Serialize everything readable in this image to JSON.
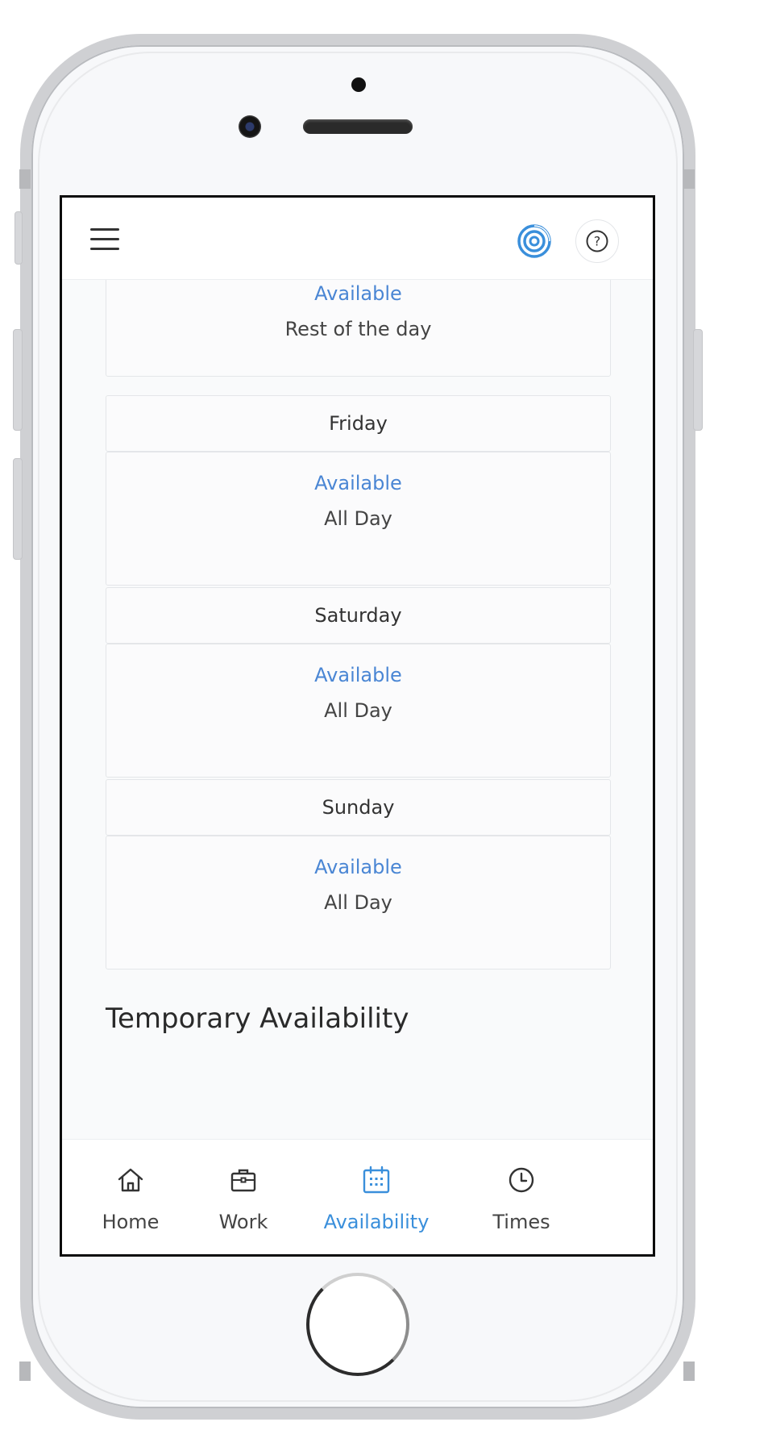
{
  "colors": {
    "accent": "#3a8fdb",
    "available_text": "#4a86d4",
    "text_dark": "#333333"
  },
  "header": {
    "menu_icon": "hamburger-menu-icon",
    "logo_icon": "concentric-circles-logo-icon",
    "help_icon": "question-mark-icon",
    "help_glyph": "?"
  },
  "schedule": {
    "partial_card": {
      "status": "Available",
      "time": "Rest of the day"
    },
    "days": [
      {
        "day": "Friday",
        "status": "Available",
        "time": "All Day"
      },
      {
        "day": "Saturday",
        "status": "Available",
        "time": "All Day"
      },
      {
        "day": "Sunday",
        "status": "Available",
        "time": "All Day"
      }
    ]
  },
  "section_title": "Temporary Availability",
  "nav": {
    "items": [
      {
        "label": "Home",
        "icon": "home-icon"
      },
      {
        "label": "Work",
        "icon": "briefcase-icon"
      },
      {
        "label": "Availability",
        "icon": "calendar-icon",
        "active": true
      },
      {
        "label": "Times",
        "icon": "clock-icon"
      }
    ]
  }
}
